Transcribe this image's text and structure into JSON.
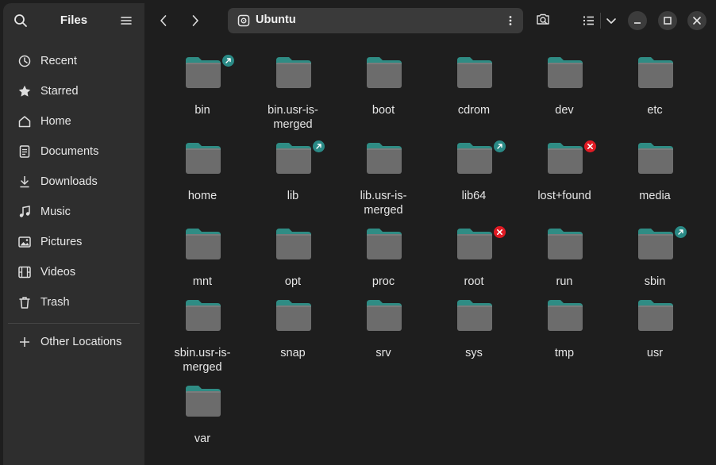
{
  "sidebar": {
    "title": "Files",
    "items": [
      {
        "label": "Recent",
        "icon": "recent-icon"
      },
      {
        "label": "Starred",
        "icon": "star-icon"
      },
      {
        "label": "Home",
        "icon": "home-icon"
      },
      {
        "label": "Documents",
        "icon": "documents-icon"
      },
      {
        "label": "Downloads",
        "icon": "downloads-icon"
      },
      {
        "label": "Music",
        "icon": "music-icon"
      },
      {
        "label": "Pictures",
        "icon": "pictures-icon"
      },
      {
        "label": "Videos",
        "icon": "videos-icon"
      },
      {
        "label": "Trash",
        "icon": "trash-icon"
      }
    ],
    "other_locations": "Other Locations"
  },
  "pathbar": {
    "label": "Ubuntu",
    "icon": "drive-icon"
  },
  "colors": {
    "link_badge": "#2a8a86",
    "no_access_badge": "#e01b24",
    "folder_body": "#6c6c6c",
    "folder_tab": "#2f8c84"
  },
  "folders": [
    {
      "name": "bin",
      "badge": "link"
    },
    {
      "name": "bin.usr-is-\nmerged",
      "badge": ""
    },
    {
      "name": "boot",
      "badge": ""
    },
    {
      "name": "cdrom",
      "badge": ""
    },
    {
      "name": "dev",
      "badge": ""
    },
    {
      "name": "etc",
      "badge": ""
    },
    {
      "name": "home",
      "badge": ""
    },
    {
      "name": "lib",
      "badge": "link"
    },
    {
      "name": "lib.usr-is-\nmerged",
      "badge": ""
    },
    {
      "name": "lib64",
      "badge": "link"
    },
    {
      "name": "lost+found",
      "badge": "no-access"
    },
    {
      "name": "media",
      "badge": ""
    },
    {
      "name": "mnt",
      "badge": ""
    },
    {
      "name": "opt",
      "badge": ""
    },
    {
      "name": "proc",
      "badge": ""
    },
    {
      "name": "root",
      "badge": "no-access"
    },
    {
      "name": "run",
      "badge": ""
    },
    {
      "name": "sbin",
      "badge": "link"
    },
    {
      "name": "sbin.usr-is-\nmerged",
      "badge": ""
    },
    {
      "name": "snap",
      "badge": ""
    },
    {
      "name": "srv",
      "badge": ""
    },
    {
      "name": "sys",
      "badge": ""
    },
    {
      "name": "tmp",
      "badge": ""
    },
    {
      "name": "usr",
      "badge": ""
    },
    {
      "name": "var",
      "badge": ""
    }
  ]
}
